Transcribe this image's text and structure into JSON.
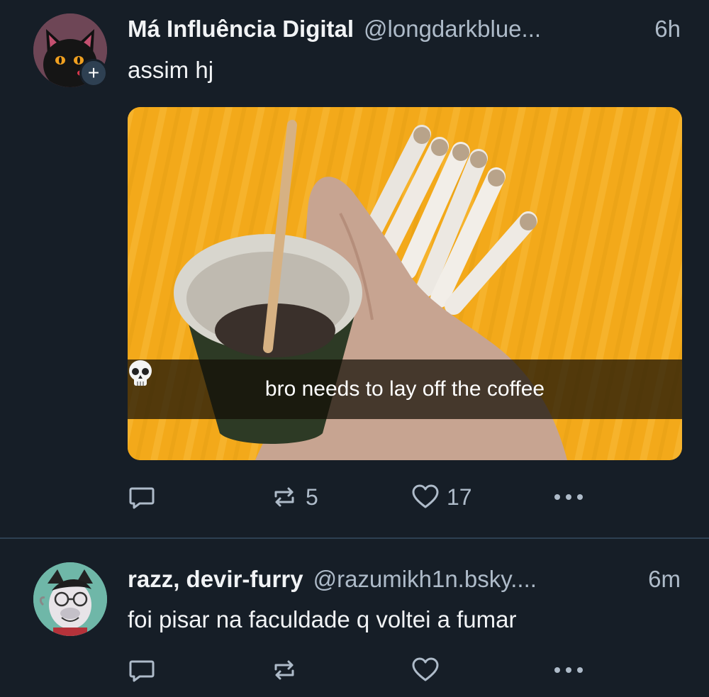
{
  "posts": [
    {
      "author_name": "Má Influência Digital",
      "handle": "@longdarkblue...",
      "time": "6h",
      "text": "assim hj",
      "media_caption": "bro needs to lay off the coffee",
      "follow_badge": "+",
      "repost_count": "5",
      "like_count": "17"
    },
    {
      "author_name": "razz, devir-furry",
      "handle": "@razumikh1n.bsky....",
      "time": "6m",
      "text": "foi pisar na faculdade q voltei a fumar",
      "repost_count": "",
      "like_count": ""
    }
  ],
  "icons": {
    "reply": "speech-bubble-icon",
    "repost": "repost-arrows-icon",
    "like": "heart-outline-icon",
    "more": "ellipsis-icon"
  },
  "colors": {
    "background": "#161e27",
    "text": "#f1f3f5",
    "muted": "#aebbc9",
    "divider": "#2e4052",
    "media_background": "#f3a91a"
  }
}
